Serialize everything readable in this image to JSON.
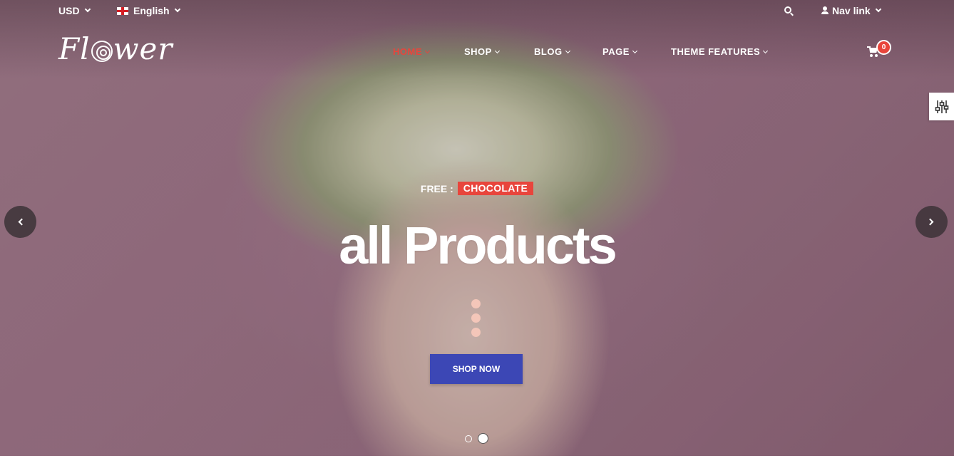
{
  "topbar": {
    "currency": "USD",
    "language": "English",
    "nav_link": "Nav link"
  },
  "logo": {
    "text_before": "Fl",
    "text_after": "wer"
  },
  "nav": {
    "items": [
      {
        "label": "HOME",
        "active": true
      },
      {
        "label": "SHOP",
        "active": false
      },
      {
        "label": "BLOG",
        "active": false
      },
      {
        "label": "PAGE",
        "active": false
      },
      {
        "label": "THEME FEATURES",
        "active": false
      }
    ]
  },
  "cart": {
    "count": "0"
  },
  "hero": {
    "free_label": "FREE :",
    "free_badge": "CHOCOLATE",
    "headline": "all Products",
    "cta": "SHOP NOW",
    "slides": 2,
    "active_slide": 2
  },
  "colors": {
    "accent": "#e8453c",
    "button": "#3c47b5"
  },
  "icons": [
    "chevron-down-icon",
    "uk-flag-icon",
    "search-icon",
    "user-icon",
    "cart-icon",
    "settings-sliders-icon",
    "chevron-left-icon",
    "chevron-right-icon"
  ]
}
